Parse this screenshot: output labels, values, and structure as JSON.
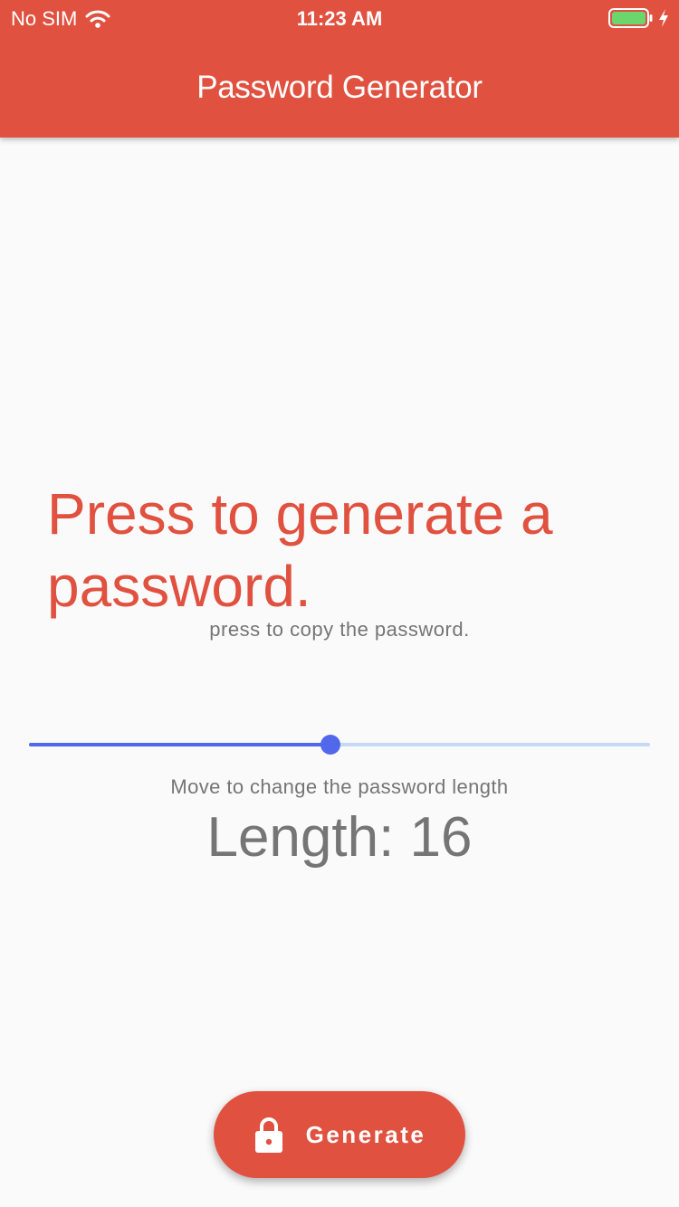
{
  "status_bar": {
    "carrier": "No SIM",
    "time": "11:23 AM",
    "wifi_icon": "wifi-icon",
    "battery_icon": "battery-charging-icon",
    "battery_level": 1.0
  },
  "app_bar": {
    "title": "Password Generator"
  },
  "main": {
    "password_text": "Press to generate a password.",
    "copy_hint": "press to copy the password.",
    "slider": {
      "value": 16,
      "min": 1,
      "max": 34,
      "fraction": 0.485
    },
    "slider_hint": "Move to change the password length",
    "length_label": "Length: 16"
  },
  "fab": {
    "icon": "lock-icon",
    "label": "Generate"
  },
  "colors": {
    "primary": "#e05140",
    "accent": "#5168ea",
    "accent_light": "#c6d8f5",
    "background": "#fafafa",
    "secondary_text": "#757575"
  }
}
